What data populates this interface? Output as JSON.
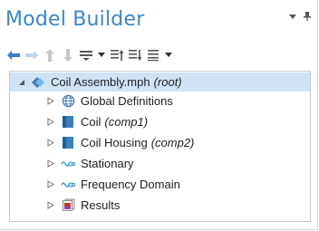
{
  "window": {
    "title": "Model Builder"
  },
  "toolbar": {
    "buttons": [
      "back-arrow-icon",
      "forward-arrow-icon",
      "move-up-icon",
      "move-down-icon",
      "show-options-icon",
      "expand-sections-icon",
      "collapse-sections-icon",
      "expand-all-icon",
      "more-options-icon"
    ]
  },
  "tree": {
    "root": {
      "label": "Coil Assembly.mph",
      "tag": "(root)"
    },
    "items": [
      {
        "label": "Global Definitions",
        "tag": ""
      },
      {
        "label": "Coil",
        "tag": "(comp1)"
      },
      {
        "label": "Coil Housing",
        "tag": "(comp2)"
      },
      {
        "label": "Stationary",
        "tag": ""
      },
      {
        "label": "Frequency Domain",
        "tag": ""
      },
      {
        "label": "Results",
        "tag": ""
      }
    ]
  },
  "colors": {
    "title": "#3a88c6",
    "selection": "#cfe3f5",
    "icon_blue": "#3a7fc0"
  }
}
